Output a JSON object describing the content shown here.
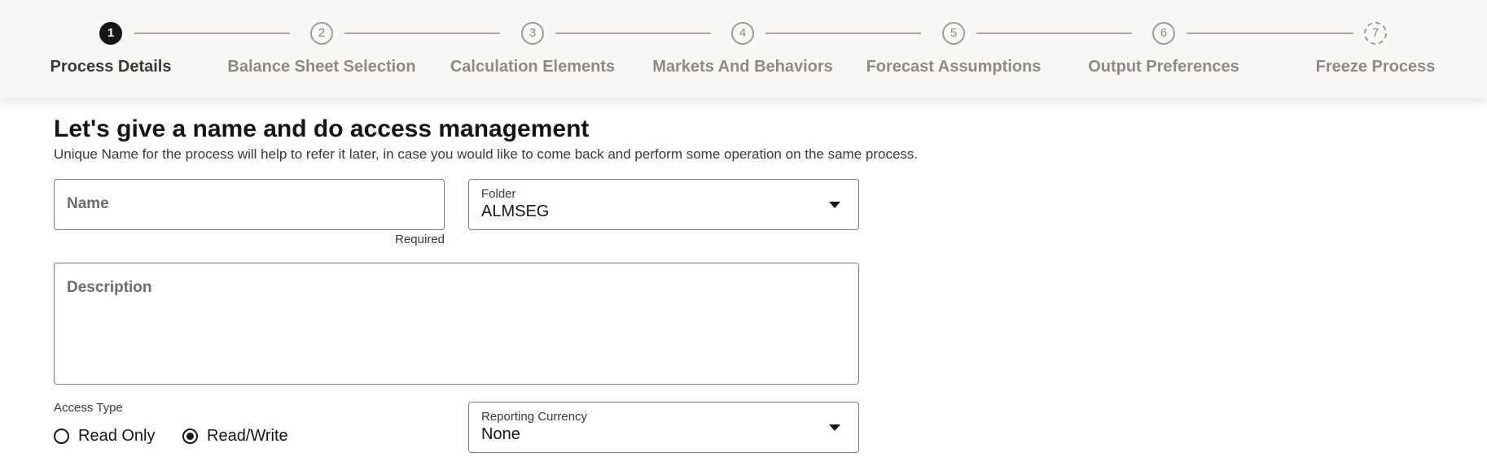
{
  "stepper": {
    "steps": [
      {
        "number": "1",
        "label": "Process Details",
        "state": "active"
      },
      {
        "number": "2",
        "label": "Balance Sheet Selection",
        "state": "normal"
      },
      {
        "number": "3",
        "label": "Calculation Elements",
        "state": "normal"
      },
      {
        "number": "4",
        "label": "Markets And Behaviors",
        "state": "normal"
      },
      {
        "number": "5",
        "label": "Forecast Assumptions",
        "state": "normal"
      },
      {
        "number": "6",
        "label": "Output Preferences",
        "state": "normal"
      },
      {
        "number": "7",
        "label": "Freeze Process",
        "state": "pending"
      }
    ]
  },
  "main": {
    "heading": "Let's give a name and do access management",
    "subtext": "Unique Name for the process will help to refer it later, in case you would like to come back and perform some operation on the same process."
  },
  "form": {
    "name": {
      "placeholder": "Name",
      "hint": "Required"
    },
    "folder": {
      "label": "Folder",
      "value": "ALMSEG"
    },
    "description": {
      "placeholder": "Description"
    },
    "access_type": {
      "label": "Access Type",
      "options": [
        "Read Only",
        "Read/Write"
      ],
      "selected": "Read/Write"
    },
    "reporting_currency": {
      "label": "Reporting Currency",
      "value": "None"
    }
  },
  "colors": {
    "active_step": "#161513",
    "inactive_step": "#8d8a86",
    "train_background": "#f9f8f6"
  }
}
